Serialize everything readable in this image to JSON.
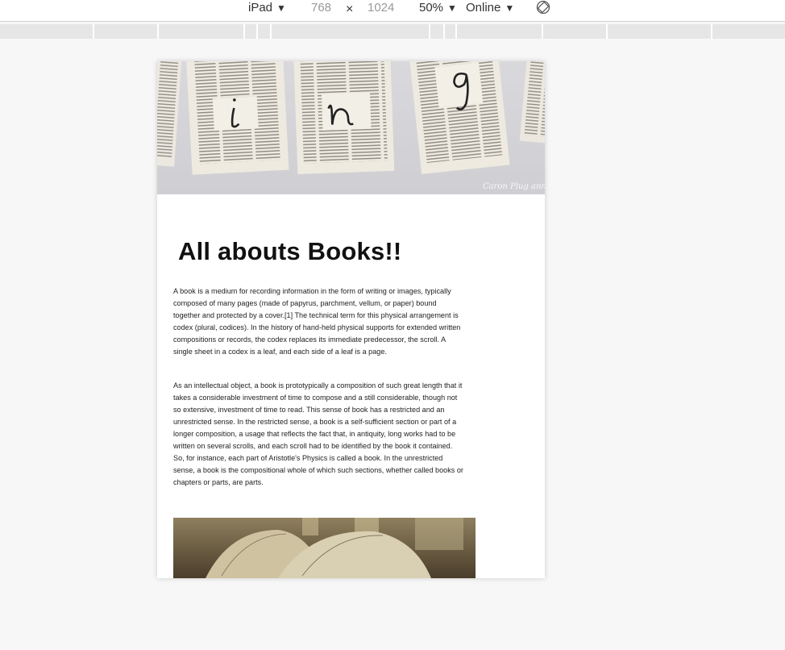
{
  "toolbar": {
    "device": "iPad",
    "width": "768",
    "separator": "×",
    "height": "1024",
    "zoom": "50%",
    "network": "Online",
    "caret": "▼",
    "rotate_icon": "rotate-icon"
  },
  "page": {
    "hero_watermark": "Caron Plug ann",
    "hero_letters": [
      "i",
      "n",
      "g"
    ],
    "heading": "All abouts Books!!",
    "paragraphs": [
      "A book is a medium for recording information in the form of writing or images, typically composed of many pages (made of papyrus, parchment, vellum, or paper) bound together and protected by a cover.[1] The technical term for this physical arrangement is codex (plural, codices). In the history of hand-held physical supports for extended written compositions or records, the codex replaces its immediate predecessor, the scroll. A single sheet in a codex is a leaf, and each side of a leaf is a page.",
      "As an intellectual object, a book is prototypically a composition of such great length that it takes a considerable investment of time to compose and a still considerable, though not so extensive, investment of time to read. This sense of book has a restricted and an unrestricted sense. In the restricted sense, a book is a self-sufficient section or part of a longer composition, a usage that reflects the fact that, in antiquity, long works had to be written on several scrolls, and each scroll had to be identified by the book it contained. So, for instance, each part of Aristotle's Physics is called a book. In the unrestricted sense, a book is the compositional whole of which such sections, whether called books or chapters or parts, are parts."
    ]
  }
}
